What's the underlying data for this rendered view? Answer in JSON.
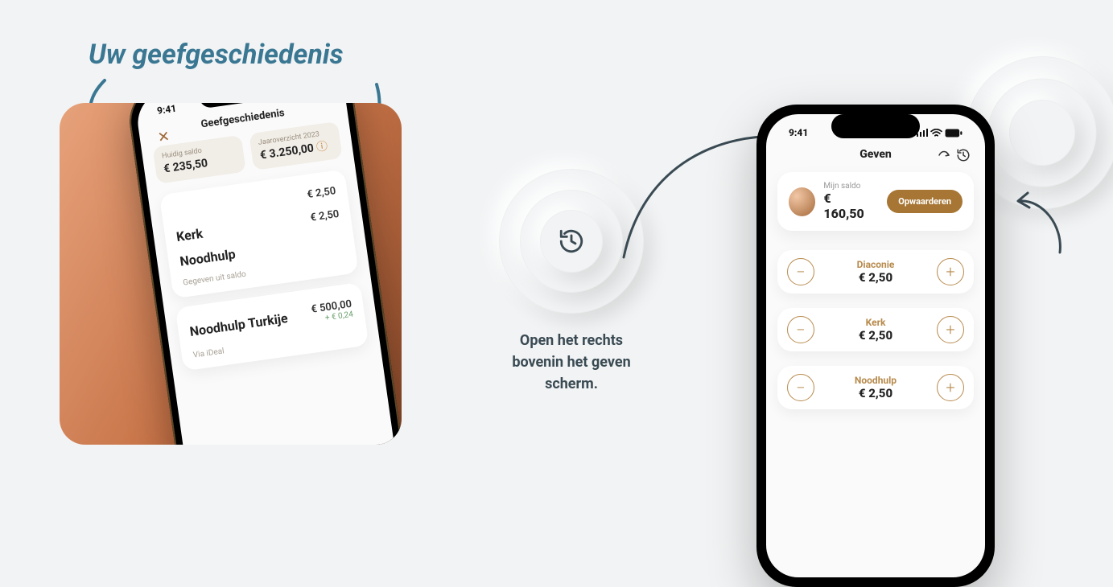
{
  "left_title": "Uw geefgeschiedenis",
  "mid_text": [
    "Open het rechts",
    "bovenin het geven",
    "scherm."
  ],
  "status_time": "9:41",
  "phone_left": {
    "header_title": "Geefgeschiedenis",
    "chip_balance_label": "Huidig saldo",
    "chip_balance_value": "€ 235,50",
    "chip_year_label": "Jaaroverzicht 2023",
    "chip_year_value": "€ 3.250,00",
    "top_amount": "€ 2,50",
    "rows": [
      {
        "name": "Kerk",
        "amount": "€ 2,50"
      },
      {
        "name": "Noodhulp",
        "amount": ""
      }
    ],
    "section_sub": "Gegeven uit saldo",
    "bigrow_name": "Noodhulp Turkije",
    "bigrow_amount": "€ 500,00",
    "bigrow_fee": "+ € 0,24",
    "via": "Via iDeal"
  },
  "phone_right": {
    "header_title": "Geven",
    "balance_label": "Mijn saldo",
    "balance_value": "€ 160,50",
    "topup_label": "Opwaarderen",
    "rows": [
      {
        "name": "Diaconie",
        "amount": "€ 2,50"
      },
      {
        "name": "Kerk",
        "amount": "€ 2,50"
      },
      {
        "name": "Noodhulp",
        "amount": "€ 2,50"
      }
    ]
  }
}
